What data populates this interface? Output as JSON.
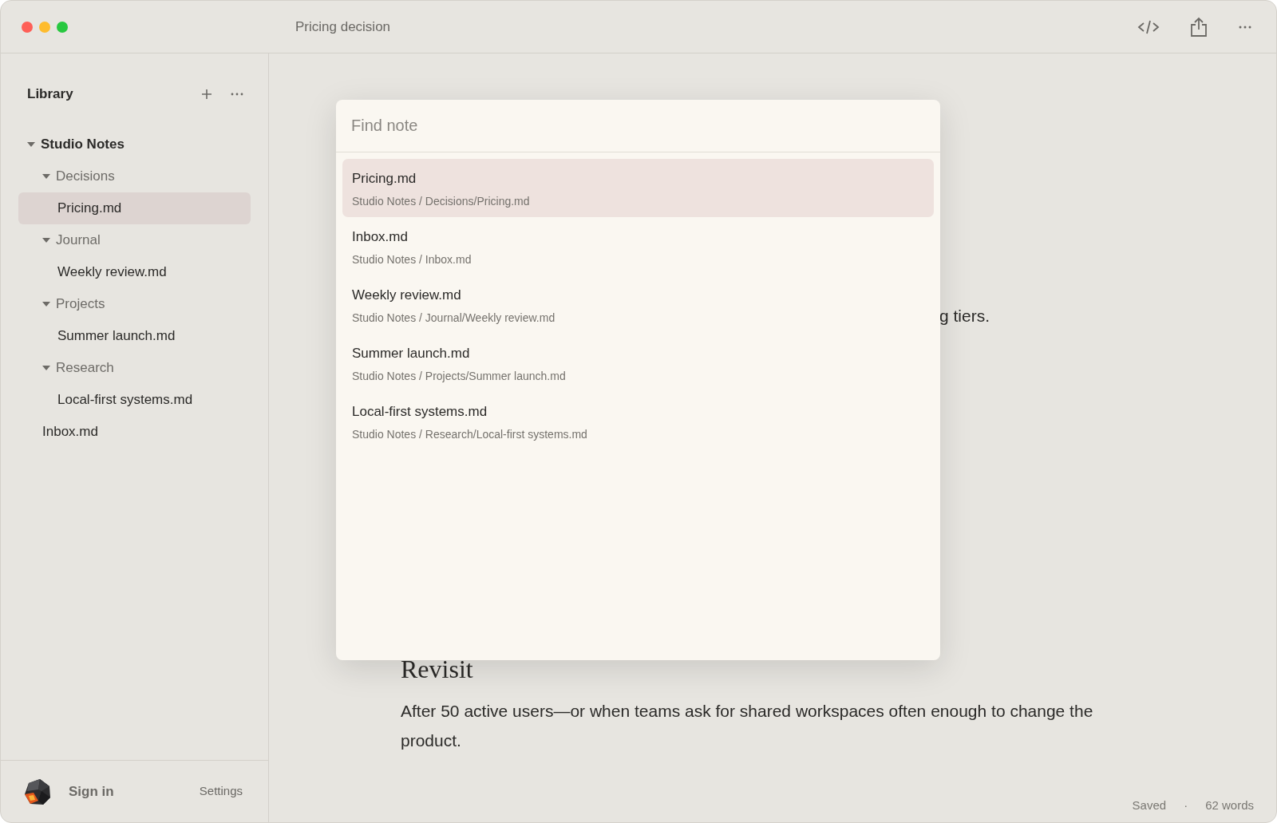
{
  "window": {
    "title": "Pricing decision"
  },
  "sidebar": {
    "title": "Library",
    "tree": [
      {
        "kind": "folder",
        "label": "Studio Notes",
        "expanded": true,
        "selected": false,
        "children": [
          {
            "kind": "folder",
            "label": "Decisions",
            "expanded": true,
            "selected": false,
            "children": [
              {
                "kind": "file",
                "label": "Pricing.md",
                "selected": true
              }
            ]
          },
          {
            "kind": "folder",
            "label": "Journal",
            "expanded": true,
            "selected": false,
            "children": [
              {
                "kind": "file",
                "label": "Weekly review.md",
                "selected": false
              }
            ]
          },
          {
            "kind": "folder",
            "label": "Projects",
            "expanded": true,
            "selected": false,
            "children": [
              {
                "kind": "file",
                "label": "Summer launch.md",
                "selected": false
              }
            ]
          },
          {
            "kind": "folder",
            "label": "Research",
            "expanded": true,
            "selected": false,
            "children": [
              {
                "kind": "file",
                "label": "Local-first systems.md",
                "selected": false
              }
            ]
          },
          {
            "kind": "file",
            "label": "Inbox.md",
            "selected": false
          }
        ]
      }
    ],
    "footer": {
      "sign_in": "Sign in",
      "settings": "Settings"
    }
  },
  "editor": {
    "partial_line": "g tiers.",
    "heading": "Revisit",
    "paragraph": "After 50 active users—or when teams ask for shared workspaces often enough to change the product."
  },
  "status_bar": {
    "saved": "Saved",
    "separator": "·",
    "words": "62 words"
  },
  "palette": {
    "placeholder": "Find note",
    "results": [
      {
        "title": "Pricing.md",
        "path": "Studio Notes / Decisions/Pricing.md",
        "selected": true
      },
      {
        "title": "Inbox.md",
        "path": "Studio Notes / Inbox.md",
        "selected": false
      },
      {
        "title": "Weekly review.md",
        "path": "Studio Notes / Journal/Weekly review.md",
        "selected": false
      },
      {
        "title": "Summer launch.md",
        "path": "Studio Notes / Projects/Summer launch.md",
        "selected": false
      },
      {
        "title": "Local-first systems.md",
        "path": "Studio Notes / Research/Local-first systems.md",
        "selected": false
      }
    ]
  }
}
